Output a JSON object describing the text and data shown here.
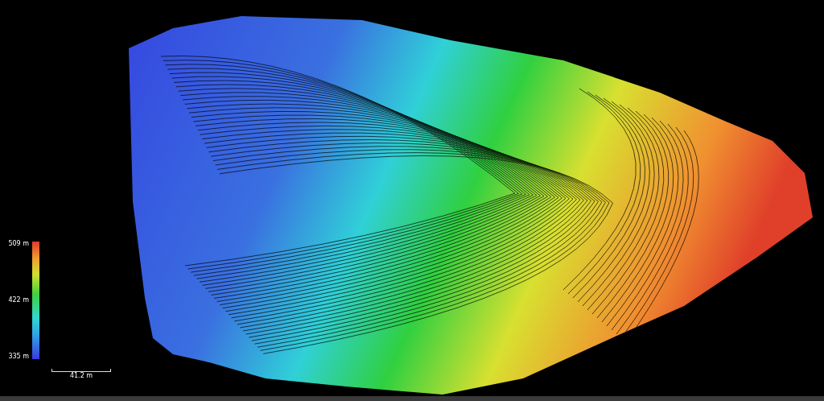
{
  "legend": {
    "labels": [
      "509 m",
      "422 m",
      "335 m"
    ]
  },
  "scale_bar": {
    "label": "41.2 m"
  }
}
